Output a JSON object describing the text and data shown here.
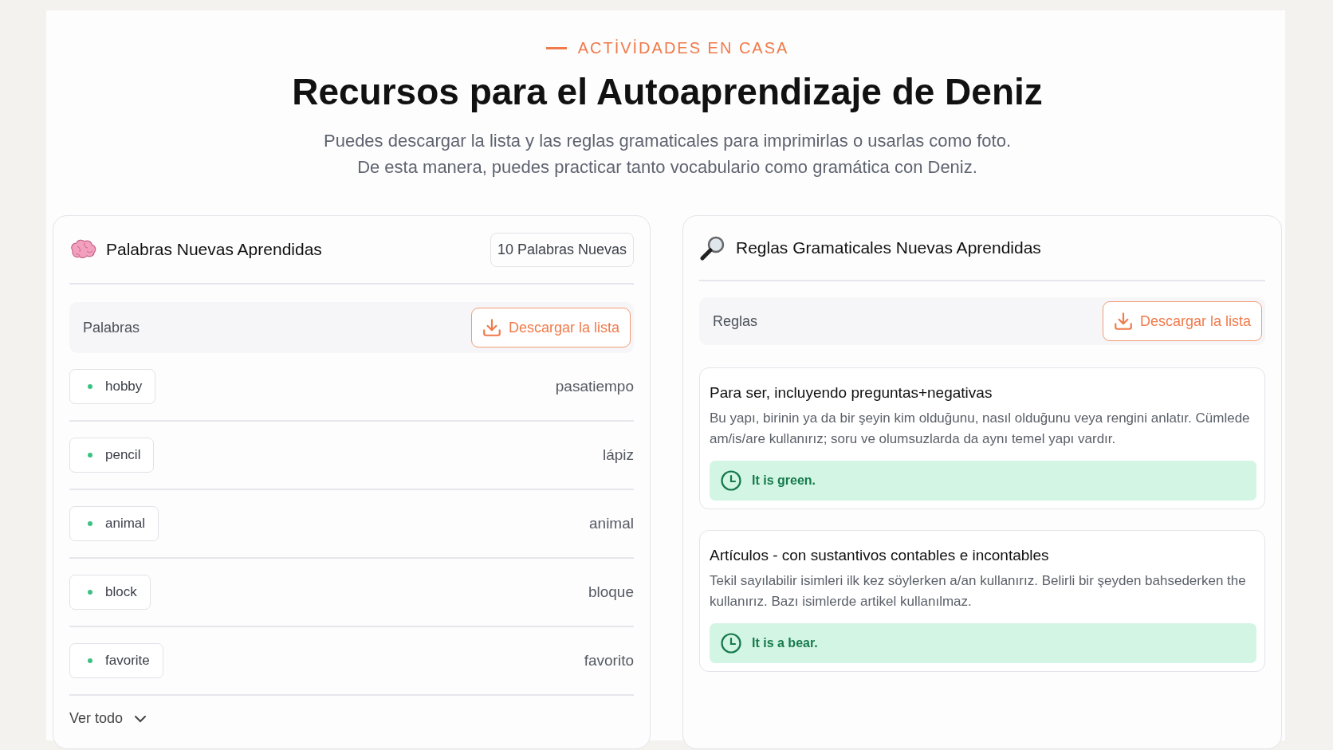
{
  "header": {
    "eyebrow": "ACTİVİDADES EN CASA",
    "title": "Recursos para el Autoaprendizaje de Deniz",
    "subtitle_lines": [
      "Puedes descargar la lista y las reglas gramaticales para imprimirlas o usarlas como foto.",
      "De esta manera, puedes practicar tanto vocabulario como gramática con Deniz."
    ]
  },
  "words_card": {
    "title": "Palabras Nuevas Aprendidas",
    "count_badge": "10 Palabras Nuevas",
    "toolbar_label": "Palabras",
    "download_button": "Descargar la lista",
    "words": [
      {
        "term": "hobby",
        "translation": "pasatiempo"
      },
      {
        "term": "pencil",
        "translation": "lápiz"
      },
      {
        "term": "animal",
        "translation": "animal"
      },
      {
        "term": "block",
        "translation": "bloque"
      },
      {
        "term": "favorite",
        "translation": "favorito"
      }
    ],
    "show_all": "Ver todo"
  },
  "rules_card": {
    "title": "Reglas Gramaticales Nuevas Aprendidas",
    "toolbar_label": "Reglas",
    "download_button": "Descargar la lista",
    "rules": [
      {
        "title": "Para ser, incluyendo preguntas+negativas",
        "description": "Bu yapı, birinin ya da bir şeyin kim olduğunu, nasıl olduğunu veya rengini anlatır. Cümlede am/is/are kullanırız; soru ve olumsuzlarda da aynı temel yapı vardır.",
        "example": "It is green."
      },
      {
        "title": "Artículos - con sustantivos contables e incontables",
        "description": "Tekil sayılabilir isimleri ilk kez söylerken a/an kullanırız. Belirli bir şeyden bahsederken the kullanırız. Bazı isimlerde artikel kullanılmaz.",
        "example": "It is a bear."
      }
    ]
  }
}
